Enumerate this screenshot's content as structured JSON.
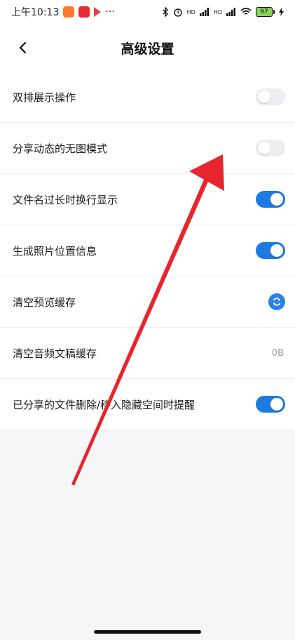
{
  "status_bar": {
    "time": "上午10:13",
    "more": "···",
    "network_1": "HD",
    "network_2": "HD",
    "battery_level": "97"
  },
  "header": {
    "title": "高级设置"
  },
  "settings": [
    {
      "label": "双排展示操作",
      "control": "toggle",
      "state": "off"
    },
    {
      "label": "分享动态的无图模式",
      "control": "toggle",
      "state": "off"
    },
    {
      "label": "文件名过长时换行显示",
      "control": "toggle",
      "state": "on"
    },
    {
      "label": "生成照片位置信息",
      "control": "toggle",
      "state": "on"
    },
    {
      "label": "清空预览缓存",
      "control": "refresh-button"
    },
    {
      "label": "清空音频文稿缓存",
      "control": "value",
      "value": "0B"
    },
    {
      "label": "已分享的文件删除/移入隐藏空间时提醒",
      "control": "toggle",
      "state": "on"
    }
  ],
  "colors": {
    "accent": "#1f7ae0",
    "toggle_off": "#eceef1",
    "arrow": "#e8242c"
  }
}
